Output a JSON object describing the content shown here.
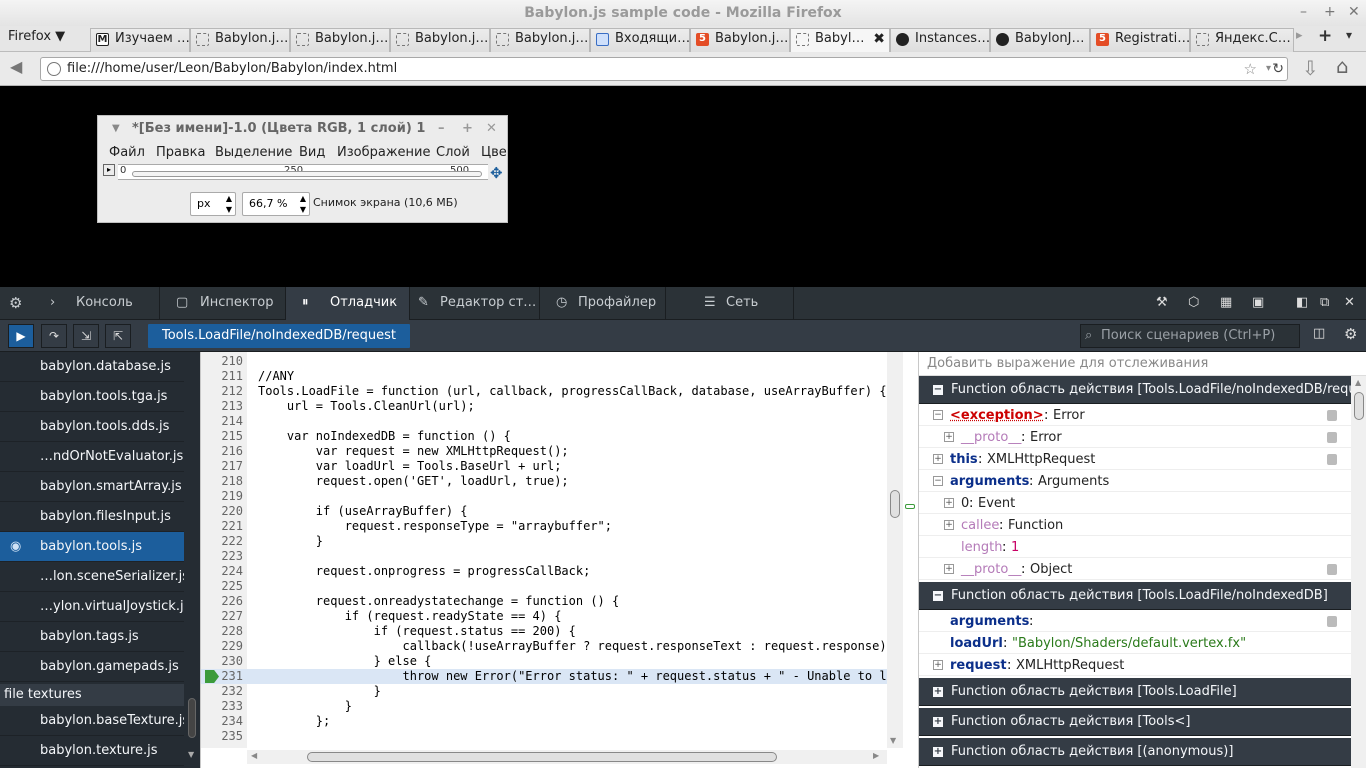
{
  "window": {
    "title": "Babylon.js sample code - Mozilla Firefox"
  },
  "firefox_menu": "Firefox ▼",
  "tabs": [
    {
      "label": "Изучаем …",
      "icon": "m"
    },
    {
      "label": "Babylon.j…",
      "icon": "page"
    },
    {
      "label": "Babylon.j…",
      "icon": "page"
    },
    {
      "label": "Babylon.j…",
      "icon": "page"
    },
    {
      "label": "Babylon.j…",
      "icon": "page"
    },
    {
      "label": "Входящи…",
      "icon": "mail"
    },
    {
      "label": "Babylon.j…",
      "icon": "html5"
    },
    {
      "label": "Babyl…",
      "icon": "page",
      "selected": true
    },
    {
      "label": "Instances…",
      "icon": "github"
    },
    {
      "label": "BabylonJ…",
      "icon": "github"
    },
    {
      "label": "Registrati…",
      "icon": "html5"
    },
    {
      "label": "Яндекс.С…",
      "icon": "doc"
    }
  ],
  "url": "file:///home/user/Leon/Babylon/Babylon/index.html",
  "gimp": {
    "title": "*[Без имени]-1.0 (Цвета RGB, 1 слой) 1",
    "menu": [
      "Файл",
      "Правка",
      "Выделение",
      "Вид",
      "Изображение",
      "Слой",
      "Цве"
    ],
    "ruler": [
      "0",
      "250",
      "500"
    ],
    "unit": "px",
    "zoom": "66,7 %",
    "status": "Снимок экрана (10,6 МБ)"
  },
  "devtools": {
    "tabs": [
      "Консоль",
      "Инспектор",
      "Отладчик",
      "Редактор ст…",
      "Профайлер",
      "Сеть"
    ],
    "breadcrumb": "Tools.LoadFile/noIndexedDB/request",
    "search_placeholder": "Поиск сценариев (Ctrl+P)",
    "watch_placeholder": "Добавить выражение для отслеживания"
  },
  "sources": [
    {
      "label": "babylon.database.js"
    },
    {
      "label": "babylon.tools.tga.js"
    },
    {
      "label": "babylon.tools.dds.js"
    },
    {
      "label": "…ndOrNotEvaluator.js"
    },
    {
      "label": "babylon.smartArray.js"
    },
    {
      "label": "babylon.filesInput.js"
    },
    {
      "label": "babylon.tools.js",
      "selected": true
    },
    {
      "label": "…lon.sceneSerializer.js"
    },
    {
      "label": "…ylon.virtualJoystick.js"
    },
    {
      "label": "babylon.tags.js"
    },
    {
      "label": "babylon.gamepads.js"
    },
    {
      "group": "file textures"
    },
    {
      "label": "babylon.baseTexture.js"
    },
    {
      "label": "babylon.texture.js"
    }
  ],
  "code": [
    {
      "n": "210",
      "t": ""
    },
    {
      "n": "211",
      "t": "//ANY"
    },
    {
      "n": "212",
      "t": "Tools.LoadFile = function (url, callback, progressCallBack, database, useArrayBuffer) {"
    },
    {
      "n": "213",
      "t": "    url = Tools.CleanUrl(url);"
    },
    {
      "n": "214",
      "t": ""
    },
    {
      "n": "215",
      "t": "    var noIndexedDB = function () {"
    },
    {
      "n": "216",
      "t": "        var request = new XMLHttpRequest();"
    },
    {
      "n": "217",
      "t": "        var loadUrl = Tools.BaseUrl + url;"
    },
    {
      "n": "218",
      "t": "        request.open('GET', loadUrl, true);"
    },
    {
      "n": "219",
      "t": ""
    },
    {
      "n": "220",
      "t": "        if (useArrayBuffer) {"
    },
    {
      "n": "221",
      "t": "            request.responseType = \"arraybuffer\";"
    },
    {
      "n": "222",
      "t": "        }"
    },
    {
      "n": "223",
      "t": ""
    },
    {
      "n": "224",
      "t": "        request.onprogress = progressCallBack;"
    },
    {
      "n": "225",
      "t": ""
    },
    {
      "n": "226",
      "t": "        request.onreadystatechange = function () {"
    },
    {
      "n": "227",
      "t": "            if (request.readyState == 4) {"
    },
    {
      "n": "228",
      "t": "                if (request.status == 200) {"
    },
    {
      "n": "229",
      "t": "                    callback(!useArrayBuffer ? request.responseText : request.response);"
    },
    {
      "n": "230",
      "t": "                } else {"
    },
    {
      "n": "231",
      "t": "                    throw new Error(\"Error status: \" + request.status + \" - Unable to loa",
      "current": true
    },
    {
      "n": "232",
      "t": "                }"
    },
    {
      "n": "233",
      "t": "            }"
    },
    {
      "n": "234",
      "t": "        };"
    },
    {
      "n": "235",
      "t": ""
    }
  ],
  "scopes": [
    {
      "title": "Function область действия [Tools.LoadFile/noIndexedDB/request.o",
      "vars": [
        {
          "name": "<exception>",
          "value": "Error",
          "twisty": "−",
          "kind": "exc",
          "lock": true
        },
        {
          "name": "__proto__",
          "value": "Error",
          "twisty": "+",
          "indent": 1,
          "kind": "light",
          "lock": true
        },
        {
          "name": "this",
          "value": "XMLHttpRequest",
          "twisty": "+",
          "lock": true
        },
        {
          "name": "arguments",
          "value": "Arguments",
          "twisty": "−"
        },
        {
          "name": "0",
          "value": "Event",
          "twisty": "+",
          "indent": 1,
          "kind": "plain"
        },
        {
          "name": "callee",
          "value": "Function",
          "twisty": "+",
          "indent": 1,
          "kind": "light"
        },
        {
          "name": "length",
          "value": "1",
          "indent": 1,
          "kind": "light",
          "vkind": "num"
        },
        {
          "name": "__proto__",
          "value": "Object",
          "twisty": "+",
          "indent": 1,
          "kind": "light",
          "lock": true
        }
      ]
    },
    {
      "title": "Function область действия [Tools.LoadFile/noIndexedDB]",
      "vars": [
        {
          "name": "arguments",
          "value": "",
          "lock": true
        },
        {
          "name": "loadUrl",
          "value": "\"Babylon/Shaders/default.vertex.fx\"",
          "vkind": "str"
        },
        {
          "name": "request",
          "value": "XMLHttpRequest",
          "twisty": "+"
        }
      ]
    },
    {
      "title": "Function область действия [Tools.LoadFile]",
      "collapsed": true
    },
    {
      "title": "Function область действия [Tools<]",
      "collapsed": true
    },
    {
      "title": "Function область действия [(anonymous)]",
      "collapsed": true
    }
  ]
}
